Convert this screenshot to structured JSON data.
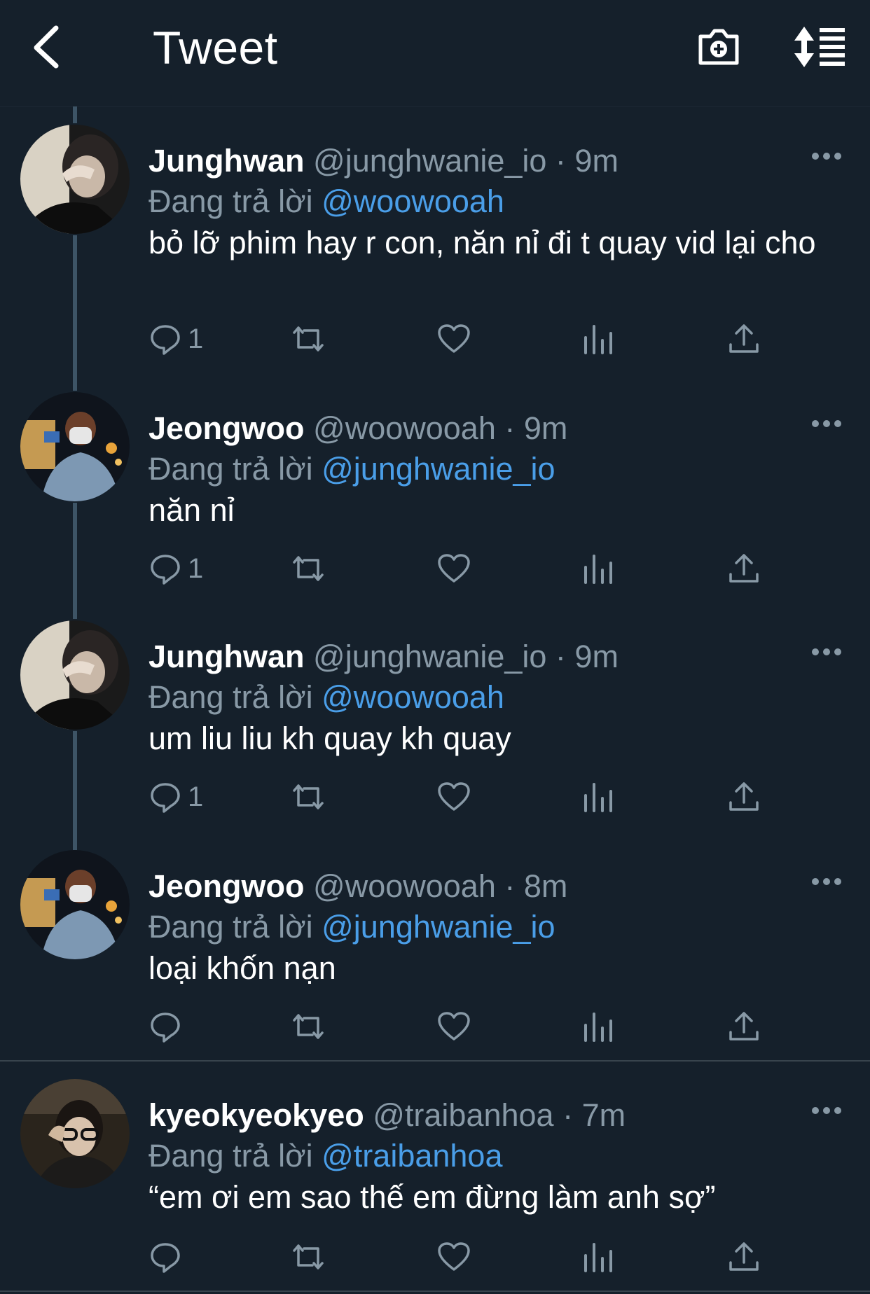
{
  "header": {
    "title": "Tweet",
    "back_icon": "chevron-left-icon",
    "camera_icon": "camera-add-icon",
    "sort_icon": "sort-list-icon"
  },
  "colors": {
    "background": "#15202b",
    "secondary_text": "#8899a6",
    "mention": "#4a9ee8",
    "thread_line": "#3d5466"
  },
  "tweets": [
    {
      "name": "Junghwan",
      "handle_time": "@junghwanie_io · 9m",
      "reply_prefix": "Đang trả lời",
      "reply_to": "@woowooah",
      "text": "bỏ lỡ phim hay r con, năn nỉ đi t quay vid lại cho",
      "reply_count": "1"
    },
    {
      "name": "Jeongwoo",
      "handle_time": "@woowooah · 9m",
      "reply_prefix": "Đang trả lời",
      "reply_to": "@junghwanie_io",
      "text": "năn nỉ",
      "reply_count": "1"
    },
    {
      "name": "Junghwan",
      "handle_time": "@junghwanie_io · 9m",
      "reply_prefix": "Đang trả lời",
      "reply_to": "@woowooah",
      "text": "um liu liu kh quay kh quay",
      "reply_count": "1"
    },
    {
      "name": "Jeongwoo",
      "handle_time": "@woowooah · 8m",
      "reply_prefix": "Đang trả lời",
      "reply_to": "@junghwanie_io",
      "text": "loại khốn nạn",
      "reply_count": ""
    },
    {
      "name": "kyeokyeokyeo",
      "handle_time": "@traibanhoa · 7m",
      "reply_prefix": "Đang trả lời",
      "reply_to": "@traibanhoa",
      "text": "“em ơi em sao thế em đừng làm anh sợ”",
      "reply_count": ""
    }
  ]
}
